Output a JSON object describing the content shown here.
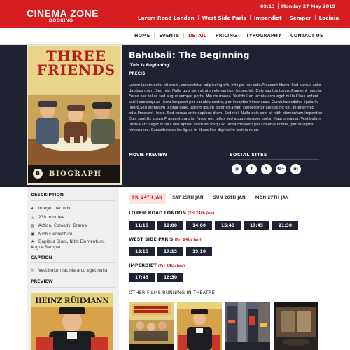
{
  "header": {
    "logo_main": "CINEMA ZONE",
    "logo_sub": "BOOKING",
    "time": "09:13",
    "date": "Monday 27 May 2019",
    "cities": [
      "Lorem Road London",
      "West Side Paris",
      "Imperdiet",
      "Semper",
      "Lacinia"
    ]
  },
  "nav": {
    "items": [
      "HOME",
      "EVENTS",
      "DETAIL",
      "PRICING",
      "TYPOGRAPHY",
      "CONTACT US"
    ],
    "active": "DETAIL"
  },
  "poster": {
    "title_line1": "THREE",
    "title_line2": "FRIENDS",
    "studio_mark": "B",
    "studio": "BIOGRAPH"
  },
  "movie": {
    "title": "Bahubali: The Beginning",
    "tagline": "'This is Beginning'",
    "precis_heading": "PRECIS",
    "precis": "Lorem ipsum dolor sit amet, consectetur adipiscing elit. Integer nec odio.Praesent libero. Sed cursus ante dapibus diam. Sed nisi. Nulla quis sem at nibh elementum imperdiet. Duis sagittis ipsum.Praesent mauris. Fusce nec tellus sed augue semper porta. Mauris massa. Vestibulum lacinia arcu eget nulla.Class aptent taciti sociosqu ad litora torquent per conubia nostra, per inceptos himenaeos. Curabiturosdales ligula in libero.Sed dignissim lacinia nunc. Lorem ipsum dolor sit amet, consectetur adipiscing elit. Integer nec odio.Praesent libero. Sed cursus ante dapibus diam. Sed nisi. Nulla quis sem at nibh elementum imperdiet. Duis sagittis ipsum.Praesent mauris. Fusce nec tellus sed augue semper porta. Mauris massa. Vestibulum lacinia arcu eget nulla.Class aptent taciti sociosqu ad litora torquent per conubia nostra, per inceptos himenaeos. Curabiturosdales ligula in libero.Sed dignissim lacinia nunc.",
    "preview_heading": "MOVIE PREVIEW",
    "social_heading": "SOCIAL SITES",
    "social_icons": [
      {
        "name": "rss-icon",
        "glyph": "◉"
      },
      {
        "name": "facebook-icon",
        "glyph": "f"
      },
      {
        "name": "twitter-icon",
        "glyph": "t"
      },
      {
        "name": "googleplus-icon",
        "glyph": "G+"
      },
      {
        "name": "linkedin-icon",
        "glyph": "in"
      }
    ]
  },
  "sidebar": {
    "description_heading": "DESCRIPTION",
    "items": [
      {
        "icon": "volume-icon",
        "glyph": "◂",
        "text": "Integer nec odio"
      },
      {
        "icon": "clock-icon",
        "glyph": "◷",
        "text": "238 minutes"
      },
      {
        "icon": "film-icon",
        "glyph": "▤",
        "text": "Action, Comedy, Drama"
      },
      {
        "icon": "image-icon",
        "glyph": "▣",
        "text": "Nibh Elementum"
      },
      {
        "icon": "star-icon",
        "glyph": "★",
        "text": "Dapibus Diam, Nibh Elementum, Augue Semper"
      }
    ],
    "caption_heading": "CAPTION",
    "caption_item": {
      "icon": "thumbs-up-icon",
      "glyph": "✌",
      "text": "Vestibulum lacinia arcu eget nulla"
    },
    "preview_heading": "PREVIEW",
    "preview_poster_title": "HEINZ RÜHMANN"
  },
  "schedule": {
    "tabs": [
      "FRI 24TH JAN",
      "SAT 25TH JAN",
      "SUN 26TH JAN",
      "MON 27TH JAN"
    ],
    "active_tab": "FRI 24TH JAN",
    "venues": [
      {
        "name": "LOREM ROAD LONDON",
        "date": "(Fri 24th Jan)",
        "times": [
          "11:15",
          "12:00",
          "14:00",
          "15:45",
          "17:45",
          "21:30"
        ]
      },
      {
        "name": "WEST SIDE PARIS",
        "date": "(Fri 24th Jan)",
        "times": [
          "13:15",
          "17:15",
          "19:10"
        ]
      },
      {
        "name": "IMPERDIET",
        "date": "(Fri 24th Jan)",
        "times": [
          "17:45",
          "18:30"
        ]
      }
    ],
    "other_films_heading": "OTHER FILMS RUNNING IN THEATRE"
  },
  "colors": {
    "brand_red": "#d61d20",
    "hero_dark": "#1f2230",
    "sidebar_bg": "#efeff1"
  }
}
